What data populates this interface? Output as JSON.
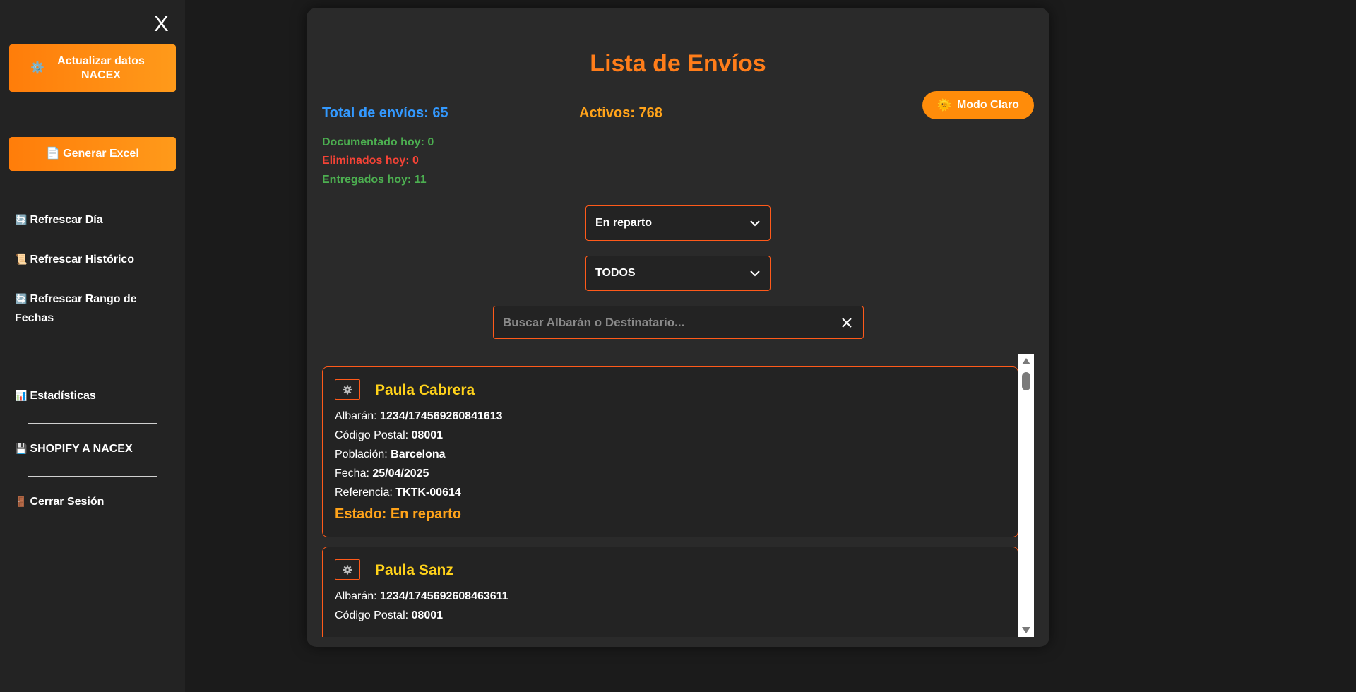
{
  "sidebar": {
    "close_label": "X",
    "update_button": {
      "icon": "⚙️",
      "label": "Actualizar datos NACEX"
    },
    "excel_button": {
      "icon": "📄",
      "label": "Generar Excel"
    },
    "links": [
      {
        "icon": "🔄",
        "label": "Refrescar Día"
      },
      {
        "icon": "📜",
        "label": "Refrescar Histórico"
      },
      {
        "icon": "🔄",
        "label": "Refrescar Rango de Fechas"
      },
      {
        "icon": "📊",
        "label": "Estadísticas"
      },
      {
        "icon": "💾",
        "label": "SHOPIFY A NACEX"
      },
      {
        "icon": "🚪",
        "label": "Cerrar Sesión"
      }
    ]
  },
  "main": {
    "title": "Lista de Envíos",
    "total_label": "Total de envíos: 65",
    "activos_label": "Activos: 768",
    "mode_button": {
      "icon": "🌞",
      "label": "Modo Claro"
    },
    "stats": {
      "documentado": "Documentado hoy: 0",
      "eliminados": "Eliminados hoy: 0",
      "entregados": "Entregados hoy: 11"
    },
    "status_select": "En reparto",
    "type_select": "TODOS",
    "search": {
      "placeholder": "Buscar Albarán o Destinatario...",
      "value": ""
    }
  },
  "shipments": [
    {
      "name": "Paula Cabrera",
      "albaran_label": "Albarán:",
      "albaran": "1234/174569260841613",
      "cp_label": "Código Postal:",
      "cp": "08001",
      "poblacion_label": "Población:",
      "poblacion": "Barcelona",
      "fecha_label": "Fecha:",
      "fecha": "25/04/2025",
      "referencia_label": "Referencia:",
      "referencia": "TKTK-00614",
      "estado": "Estado: En reparto"
    },
    {
      "name": "Paula Sanz",
      "albaran_label": "Albarán:",
      "albaran": "1234/1745692608463611",
      "cp_label": "Código Postal:",
      "cp": "08001"
    }
  ],
  "colors": {
    "accent": "#ff7d1a",
    "border": "#ff5a1a",
    "name": "#ffd21a",
    "total": "#3399ff",
    "green": "#4caf50",
    "red": "#f44336"
  }
}
